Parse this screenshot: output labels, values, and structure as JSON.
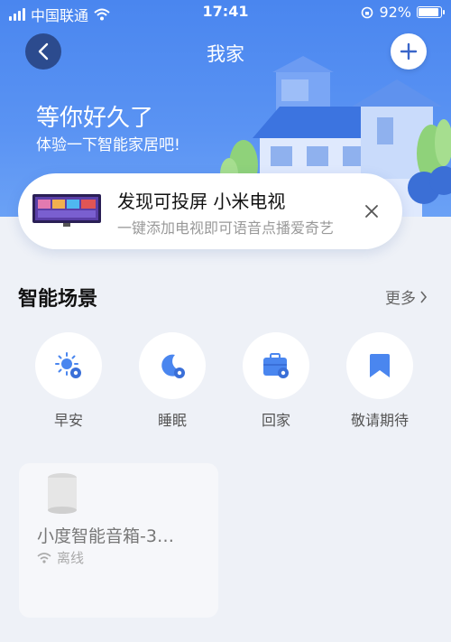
{
  "status_bar": {
    "carrier": "中国联通",
    "time": "17:41",
    "battery": "92%",
    "battery_level": 0.92
  },
  "nav": {
    "title": "我家",
    "back_icon": "chevron-left-icon",
    "add_icon": "plus-icon"
  },
  "hero": {
    "greeting": "等你好久了",
    "subtitle": "体验一下智能家居吧!"
  },
  "promo": {
    "title": "发现可投屏 小米电视",
    "subtitle": "一键添加电视即可语音点播爱奇艺"
  },
  "scenes": {
    "title": "智能场景",
    "more": "更多",
    "items": [
      {
        "label": "早安",
        "icon": "sun-gear-icon"
      },
      {
        "label": "睡眠",
        "icon": "moon-gear-icon"
      },
      {
        "label": "回家",
        "icon": "briefcase-gear-icon"
      },
      {
        "label": "敬请期待",
        "icon": "bookmark-icon"
      }
    ]
  },
  "devices": [
    {
      "name": "小度智能音箱-3…",
      "status": "离线",
      "icon": "smart-speaker-icon"
    }
  ],
  "colors": {
    "accent": "#4a86ef",
    "back_button": "#2c4b8e"
  }
}
